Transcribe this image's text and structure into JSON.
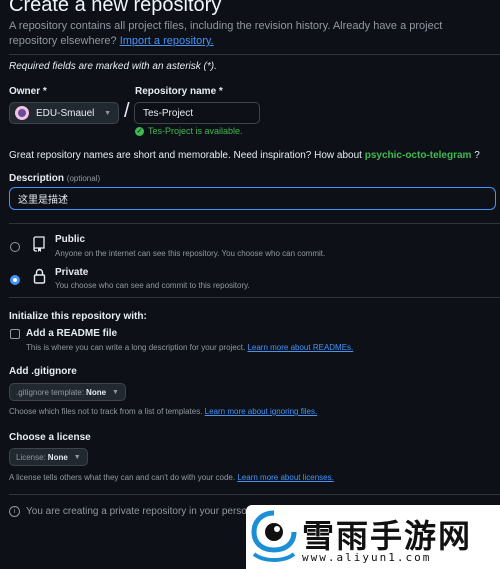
{
  "header": {
    "title": "Create a new repository",
    "intro_text": "A repository contains all project files, including the revision history. Already have a project repository elsewhere?",
    "import_link": "Import a repository."
  },
  "form": {
    "required_note": "Required fields are marked with an asterisk (*).",
    "owner": {
      "label": "Owner *",
      "value": "EDU-Smauel"
    },
    "repo_name": {
      "label": "Repository name *",
      "value": "Tes-Project",
      "status": "Tes-Project is available."
    },
    "inspiration": {
      "text": "Great repository names are short and memorable. Need inspiration? How about",
      "suggestion": "psychic-octo-telegram",
      "suffix": "?"
    },
    "description": {
      "label": "Description",
      "optional": "(optional)",
      "value": "这里是描述"
    }
  },
  "visibility": {
    "selected": "private",
    "options": [
      {
        "title": "Public",
        "desc": "Anyone on the internet can see this repository. You choose who can commit."
      },
      {
        "title": "Private",
        "desc": "You choose who can see and commit to this repository."
      }
    ]
  },
  "init": {
    "heading": "Initialize this repository with:",
    "readme": {
      "label": "Add a README file",
      "checked": false,
      "help": "This is where you can write a long description for your project.",
      "link": "Learn more about READMEs."
    },
    "gitignore": {
      "heading": "Add .gitignore",
      "select_prefix": ".gitignore template:",
      "select_value": "None",
      "help": "Choose which files not to track from a list of templates.",
      "link": "Learn more about ignoring files."
    },
    "license": {
      "heading": "Choose a license",
      "select_prefix": "License:",
      "select_value": "None",
      "help": "A license tells others what they can and can't do with your code.",
      "link": "Learn more about licenses."
    }
  },
  "banner": {
    "text": "You are creating a private repository in your perso"
  },
  "watermark": {
    "title": "雪雨手游网",
    "url": "www.aliyun1.com"
  },
  "icons": {
    "info": "info-icon",
    "check": "check-circle-icon",
    "repo": "repo-icon",
    "lock": "lock-icon",
    "caret": "caret-down-icon"
  },
  "colors": {
    "accent": "#4493f8",
    "success": "#3fb950",
    "background": "#0d1117"
  }
}
